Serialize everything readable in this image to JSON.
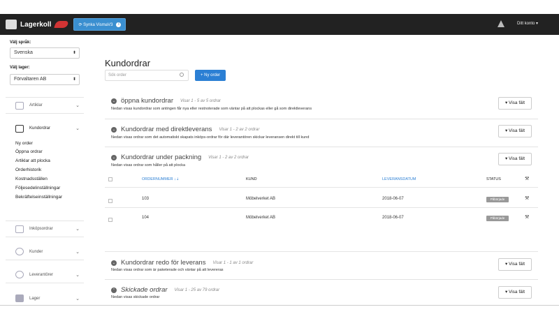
{
  "topbar": {
    "brand": "Lagerkoll",
    "sync_label": "⟳ Synka VismaV3",
    "sync_info": "i",
    "account": "Ditt konto ▾"
  },
  "sidebar": {
    "language_label": "Välj språk:",
    "language_value": "Svenska",
    "warehouse_label": "Välj lager:",
    "warehouse_value": "Förvaltaren AB",
    "nav": [
      {
        "label": "Artiklar"
      },
      {
        "label": "Kundordrar"
      },
      {
        "label": "Inköpsordrar"
      },
      {
        "label": "Kunder"
      },
      {
        "label": "Leverantörer"
      },
      {
        "label": "Lager"
      }
    ],
    "sub_items": [
      "Ny order",
      "Öppna ordrar",
      "Artiklar att plocka",
      "Orderhistorik",
      "Kostnadsställen",
      "Följesedelinställningar",
      "Bekräftelseinställningar"
    ]
  },
  "main": {
    "title": "Kundordrar",
    "search_placeholder": "Sök order",
    "new_order": "+ Ny order",
    "show_fields": "▾ Visa fält",
    "panels": [
      {
        "title": "öppna kundordrar",
        "count": "Visar 1 - 5 av 5 ordrar",
        "desc": "Nedan visas kundordrar som antingen får nya eller restnoterade som väntar på att plockas eller gå som direktleverans"
      },
      {
        "title": "Kundordrar med direktleverans",
        "count": "Visar 1 - 2 av 2 ordrar",
        "desc": "Nedan visas ordrar som det automatiskt skapats inköps-ordrar för där leverantören skickar leveransen direkt till kund"
      },
      {
        "title": "Kundordrar under packning",
        "count": "Visar 1 - 2 av 2 ordrar",
        "desc": "Nedan visas ordrar som håller på att plocka"
      },
      {
        "title": "Kundordrar redo för leverans",
        "count": "Visar 1 - 1 av 1 ordrar",
        "desc": "Nedan visas ordrar som är paketerade och väntar på att levereras"
      },
      {
        "title": "Skickade ordrar",
        "count": "Visar 1 - 25 av 79 ordrar",
        "desc": "Nedan visas skickade ordrar"
      }
    ],
    "table": {
      "headers": [
        "ORDERNUMMER ↓⇣",
        "KUND",
        "LEVERANSDATUM",
        "STATUS"
      ],
      "rows": [
        {
          "order": "103",
          "customer": "Möbelverket AB",
          "date": "2018-06-07",
          "status": "Påbörjade"
        },
        {
          "order": "104",
          "customer": "Möbelverket AB",
          "date": "2018-06-07",
          "status": "Påbörjade"
        }
      ]
    }
  }
}
